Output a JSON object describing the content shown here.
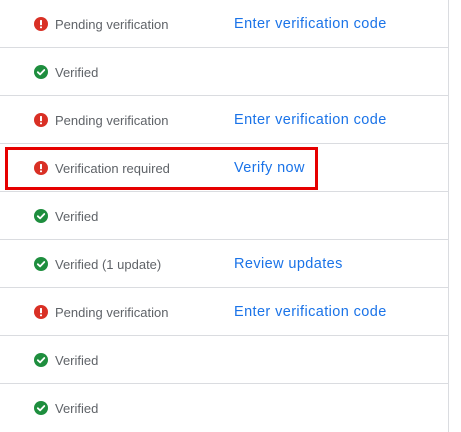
{
  "rows": [
    {
      "status": "error",
      "icon": "error-circle-icon",
      "text": "Pending verification",
      "action": "Enter verification code"
    },
    {
      "status": "ok",
      "icon": "check-circle-icon",
      "text": "Verified",
      "action": ""
    },
    {
      "status": "error",
      "icon": "error-circle-icon",
      "text": "Pending verification",
      "action": "Enter verification code"
    },
    {
      "status": "error",
      "icon": "error-circle-icon",
      "text": "Verification required",
      "action": "Verify now",
      "highlighted": true
    },
    {
      "status": "ok",
      "icon": "check-circle-icon",
      "text": "Verified",
      "action": ""
    },
    {
      "status": "ok",
      "icon": "check-circle-icon",
      "text": "Verified (1 update)",
      "action": "Review updates"
    },
    {
      "status": "error",
      "icon": "error-circle-icon",
      "text": "Pending verification",
      "action": "Enter verification code"
    },
    {
      "status": "ok",
      "icon": "check-circle-icon",
      "text": "Verified",
      "action": ""
    },
    {
      "status": "ok",
      "icon": "check-circle-icon",
      "text": "Verified",
      "action": ""
    }
  ],
  "colors": {
    "error": "#d93025",
    "ok": "#1e8e3e",
    "link": "#1a73e8",
    "highlight": "#e60000"
  }
}
